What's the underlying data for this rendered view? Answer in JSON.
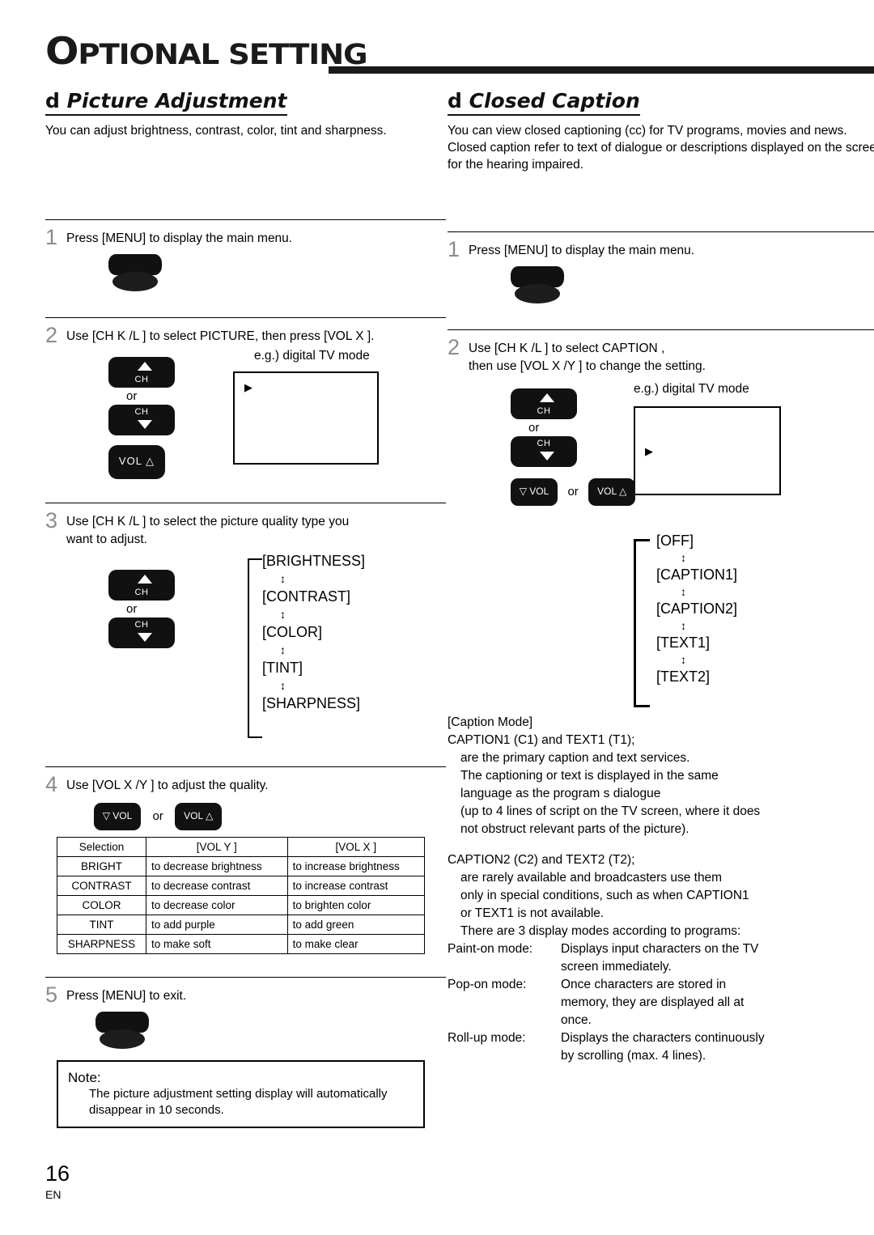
{
  "header": {
    "title_first": "O",
    "title_rest": "PTIONAL SETTING"
  },
  "left": {
    "section_bullet": "d",
    "section_title": "Picture Adjustment",
    "section_desc": "You can adjust brightness, contrast, color, tint and sharpness.",
    "steps": [
      {
        "num": "1",
        "text": "Press [MENU] to display the main menu."
      },
      {
        "num": "2",
        "text": "Use [CH K /L ] to select  PICTURE, then press [VOL X ].",
        "eg": "e.g.) digital TV mode"
      },
      {
        "num": "3",
        "text": "Use [CH K /L ] to select the picture quality type you",
        "text2": "want to adjust."
      },
      {
        "num": "4",
        "text": "Use [VOL X /Y ] to adjust the quality."
      },
      {
        "num": "5",
        "text": "Press [MENU] to exit."
      }
    ],
    "or_label": "or",
    "ch_label": "CH",
    "vol_up_label": "VOL",
    "vol_down_label": "VOL",
    "quality_chain": [
      "[BRIGHTNESS]",
      "[CONTRAST]",
      "[COLOR]",
      "[TINT]",
      "[SHARPNESS]"
    ],
    "table": {
      "headers": [
        "Selection",
        "[VOL Y ]",
        "[VOL X ]"
      ],
      "rows": [
        [
          "BRIGHT",
          "to decrease brightness",
          "to increase brightness"
        ],
        [
          "CONTRAST",
          "to decrease contrast",
          "to increase contrast"
        ],
        [
          "COLOR",
          "to decrease color",
          "to brighten color"
        ],
        [
          "TINT",
          "to add purple",
          "to add green"
        ],
        [
          "SHARPNESS",
          "to make soft",
          "to make clear"
        ]
      ]
    },
    "note_title": "Note:",
    "note_body_1": "The picture adjustment setting display will automatically",
    "note_body_2": "disappear in 10 seconds."
  },
  "right": {
    "section_bullet": "d",
    "section_title": "Closed Caption",
    "section_desc_1": "You can view closed captioning (cc) for TV programs, movies and news.",
    "section_desc_2": "Closed caption refer to text of dialogue or descriptions displayed on the screen",
    "section_desc_3": "for the hearing impaired.",
    "steps": [
      {
        "num": "1",
        "text": "Press [MENU] to display the main menu."
      },
      {
        "num": "2",
        "text": "Use [CH K /L ] to select  CAPTION ,",
        "text2": "then use [VOL X /Y ] to change the setting.",
        "eg": "e.g.) digital TV mode"
      }
    ],
    "or_label": "or",
    "ch_label": "CH",
    "vol_label": "VOL",
    "caption_chain": [
      "[OFF]",
      "[CAPTION1]",
      "[CAPTION2]",
      "[TEXT1]",
      "[TEXT2]"
    ],
    "caption_mode_title": "[Caption Mode]",
    "caption_mode_lines": [
      "CAPTION1 (C1) and TEXT1 (T1);",
      "are the primary caption and text services.",
      "The captioning or text is displayed in the same",
      "language as the program s dialogue",
      "(up to 4 lines of script on the TV screen, where it does",
      "not obstruct relevant parts of the picture)."
    ],
    "caption2_lines": [
      "CAPTION2 (C2) and TEXT2 (T2);",
      "are rarely available and broadcasters use them",
      "only in special conditions, such as when  CAPTION1",
      "or  TEXT1  is not available."
    ],
    "display_modes_intro": "There are 3 display modes according to programs:",
    "modes": [
      {
        "name": "Paint-on mode:",
        "desc": "Displays input characters on the TV",
        "desc2": "screen immediately."
      },
      {
        "name": "Pop-on mode:",
        "desc": "Once characters are stored in",
        "desc2": "memory, they are displayed all at",
        "desc3": "once."
      },
      {
        "name": "Roll-up mode:",
        "desc": "Displays the characters continuously",
        "desc2": "by scrolling (max. 4 lines)."
      }
    ]
  },
  "footer": {
    "page": "16",
    "lang": "EN"
  }
}
